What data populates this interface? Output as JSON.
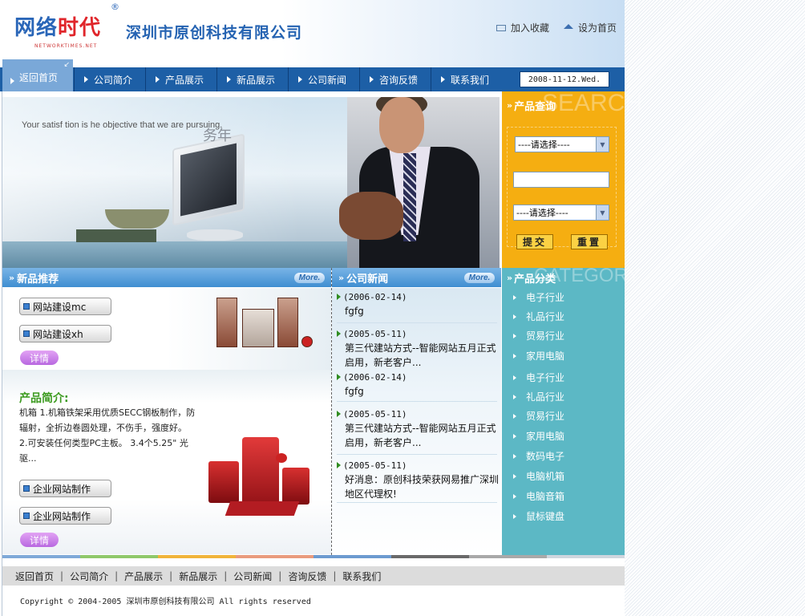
{
  "header": {
    "logo_text_a": "网络",
    "logo_text_b": "时代",
    "logo_sub": "NETWORKTIMES.NET",
    "registered": "®",
    "company": "深圳市原创科技有限公司",
    "links": [
      {
        "label": "加入收藏",
        "icon": "mail-icon"
      },
      {
        "label": "设为首页",
        "icon": "home-icon"
      }
    ]
  },
  "nav": {
    "home": "返回首页",
    "items": [
      "公司简介",
      "产品展示",
      "新品展示",
      "公司新闻",
      "咨询反馈",
      "联系我们"
    ],
    "date": "2008-11-12.Wed."
  },
  "banner": {
    "slogan": "Your satisf   tion is  he objective that we are pursuing.",
    "slogan_cn": "务年"
  },
  "search": {
    "title": "产品查询",
    "ghost": "SEARCH",
    "select1": "----请选择----",
    "select2": "----请选择----",
    "input_value": "",
    "submit": "提交",
    "reset": "重置"
  },
  "products": {
    "title": "新品推荐",
    "more": "More.",
    "buttons_top": [
      "网站建设mc",
      "网站建设xh"
    ],
    "detail": "详情",
    "intro_title": "产品简介:",
    "intro_body": "机箱  1.机箱铁架采用优质SECC钢板制作，防辐射，全折边卷圆处理，不伤手，强度好。  2.可安装任何类型PC主板。  3.4个5.25\" 光驱...",
    "buttons_bottom": [
      "企业网站制作",
      "企业网站制作"
    ],
    "detail2": "详情"
  },
  "news": {
    "title": "公司新闻",
    "more": "More.",
    "items": [
      {
        "date": "(2006-02-14)",
        "text": "fgfg"
      },
      {
        "date": "(2005-05-11)",
        "text": "第三代建站方式--智能网站五月正式启用，新老客户..."
      },
      {
        "date": "(2006-02-14)",
        "text": "fgfg"
      },
      {
        "date": "(2005-05-11)",
        "text": "第三代建站方式--智能网站五月正式启用，新老客户..."
      },
      {
        "date": "(2005-05-11)",
        "text": "好消息：原创科技荣获网易推广深圳地区代理权!"
      }
    ]
  },
  "categories": {
    "title": "产品分类",
    "ghost": "CATEGORY",
    "items": [
      "电子行业",
      "礼品行业",
      "贸易行业",
      "家用电脑",
      "电子行业",
      "礼品行业",
      "贸易行业",
      "家用电脑",
      "数码电子",
      "电脑机箱",
      "电脑音箱",
      "鼠标键盘"
    ]
  },
  "footer": {
    "links": [
      "返回首页",
      "公司简介",
      "产品展示",
      "新品展示",
      "公司新闻",
      "咨询反馈",
      "联系我们"
    ],
    "separator": "|",
    "copyright": "Copyright © 2004-2005 深圳市原创科技有限公司 All rights reserved",
    "stripe_colors": [
      "#7fa9d8",
      "#8fc86a",
      "#f0b43a",
      "#e99b7d",
      "#6d9bd0",
      "#6a6a6a",
      "#a9a9a9",
      "#cfd6de"
    ]
  },
  "colors": {
    "nav": "#1d5fa6",
    "search": "#f5ae11",
    "categories": "#5cb8c5",
    "accent_green": "#3b9a1e"
  }
}
